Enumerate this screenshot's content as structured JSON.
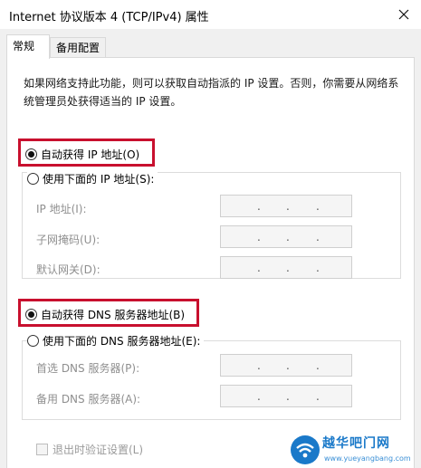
{
  "window": {
    "title": "Internet 协议版本 4 (TCP/IPv4) 属性"
  },
  "tabs": [
    {
      "label": "常规",
      "active": true
    },
    {
      "label": "备用配置",
      "active": false
    }
  ],
  "general": {
    "description": "如果网络支持此功能，则可以获取自动指派的 IP 设置。否则，你需要从网络系统管理员处获得适当的 IP 设置。",
    "auto_ip_label": "自动获得 IP 地址(O)",
    "auto_ip_checked": true,
    "manual_ip_label": "使用下面的 IP 地址(S):",
    "manual_ip_checked": false,
    "ip_fields": [
      {
        "label": "IP 地址(I):",
        "value": ".  .  ."
      },
      {
        "label": "子网掩码(U):",
        "value": ".  .  ."
      },
      {
        "label": "默认网关(D):",
        "value": ".  .  ."
      }
    ],
    "auto_dns_label": "自动获得 DNS 服务器地址(B)",
    "auto_dns_checked": true,
    "manual_dns_label": "使用下面的 DNS 服务器地址(E):",
    "manual_dns_checked": false,
    "dns_fields": [
      {
        "label": "首选 DNS 服务器(P):",
        "value": ".  .  ."
      },
      {
        "label": "备用 DNS 服务器(A):",
        "value": ".  .  ."
      }
    ],
    "validate_on_exit_label": "退出时验证设置(L)",
    "validate_on_exit_checked": false
  },
  "watermark": {
    "name": "越华吧门网",
    "url": "www.yueyangbang.com"
  },
  "colors": {
    "highlight_border": "#c8102e",
    "watermark_blue": "#1a79c9",
    "disabled_text": "#8f8f8f"
  },
  "icons": {
    "close": "close-icon",
    "watermark_logo": "wifi-logo-icon"
  }
}
